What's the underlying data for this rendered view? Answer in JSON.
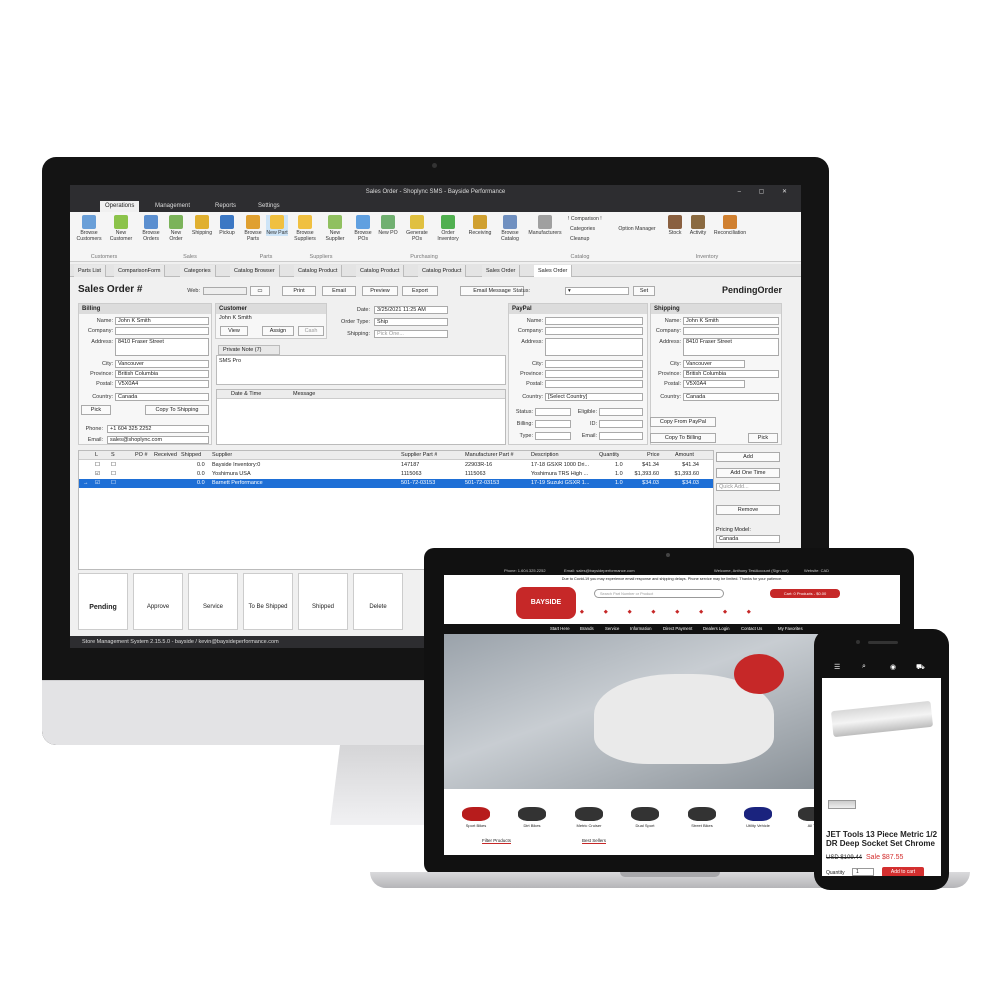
{
  "app": {
    "title": "Sales Order - Shoplync SMS - Bayside Performance",
    "menu_tabs": [
      "Operations",
      "Management",
      "Reports",
      "Settings"
    ],
    "ribbon": [
      {
        "label": "Browse Customers"
      },
      {
        "label": "New Customer"
      },
      {
        "label": "Browse Orders"
      },
      {
        "label": "New Order"
      },
      {
        "label": "Shipping"
      },
      {
        "label": "Pickup"
      },
      {
        "label": "Browse Parts"
      },
      {
        "label": "New Part"
      },
      {
        "label": "Browse Suppliers"
      },
      {
        "label": "New Supplier"
      },
      {
        "label": "Browse POs"
      },
      {
        "label": "New PO"
      },
      {
        "label": "Generate POs"
      },
      {
        "label": "Order Inventory"
      },
      {
        "label": "Receiving"
      },
      {
        "label": "Browse Catalog"
      },
      {
        "label": "Manufacturers"
      },
      {
        "label": "Stock"
      },
      {
        "label": "Activity"
      },
      {
        "label": "Reconciliation"
      }
    ],
    "ribbon_small": [
      "! Comparison !",
      "Categories",
      "Cleanup",
      "Option Manager"
    ],
    "ribbon_groups": [
      "Customers",
      "Sales",
      "Parts",
      "Suppliers",
      "Purchasing",
      "Catalog",
      "Inventory"
    ],
    "doc_tabs": [
      "Parts List",
      "ComparisonForm",
      "Categories",
      "Catalog Browser",
      "Catalog Product",
      "Catalog Product",
      "Catalog Product",
      "Sales Order",
      "Sales Order"
    ],
    "form": {
      "title": "Sales Order #",
      "web_label": "Web:",
      "print": "Print",
      "email": "Email",
      "preview": "Preview",
      "export": "Export",
      "email_message": "Email Message",
      "status_label": "Status:",
      "set": "Set",
      "order_status": "PendingOrder"
    },
    "billing": {
      "head": "Billing",
      "labels": [
        "Name:",
        "Company:",
        "Address:",
        "City:",
        "Province:",
        "Postal:",
        "Country:"
      ],
      "name": "John K Smith",
      "address": "8410 Fraser Street",
      "city": "Vancouver",
      "province": "British Columbia",
      "postal": "V5X0A4",
      "country": "Canada",
      "pick": "Pick",
      "copy": "Copy To Shipping",
      "phone_label": "Phone:",
      "phone": "+1 604 325 2252",
      "email_label": "Email:",
      "email": "sales@shoplync.com"
    },
    "customer": {
      "head": "Customer",
      "name": "John K Smith",
      "view": "View",
      "assign": "Assign",
      "cash": "Cash"
    },
    "order": {
      "date_label": "Date:",
      "date": "3/25/2021 11:25 AM",
      "type_label": "Order Type:",
      "type": "Ship",
      "shipping_label": "Shipping:",
      "shipping": "Pick One..."
    },
    "note": {
      "tab": "Private Note (7)",
      "text": "SMS Pro",
      "col_date": "Date & Time",
      "col_msg": "Message"
    },
    "paypal": {
      "head": "PayPal",
      "labels": [
        "Name:",
        "Company:",
        "Address:",
        "City:",
        "Province:",
        "Postal:",
        "Country:"
      ],
      "country": "[Select Country]",
      "status_label": "Status:",
      "billing_label": "Billing:",
      "type_label": "Type:",
      "eligible_label": "Eligible:",
      "id_label": "ID:",
      "email_label": "Email:",
      "copy_from": "Copy From PayPal",
      "copy_to": "Copy To Billing"
    },
    "shipping": {
      "head": "Shipping",
      "labels": [
        "Name:",
        "Company:",
        "Address:",
        "City:",
        "Province:",
        "Postal:",
        "Country:"
      ],
      "name": "John K Smith",
      "address": "8410 Fraser Street",
      "city": "Vancouver",
      "province": "British Columbia",
      "postal": "V5X0A4",
      "country": "Canada",
      "pick": "Pick"
    },
    "grid": {
      "headers": [
        "L",
        "S",
        "PO #",
        "Received",
        "Shipped",
        "Supplier",
        "Supplier Part #",
        "Manufacturer Part #",
        "Description",
        "Quantity",
        "Price",
        "Amount"
      ],
      "rows": [
        {
          "shipped": "0.0",
          "supplier": "Bayside Inventory:0",
          "supplier_part": "147187",
          "mfr_part": "22903R-16",
          "description": "17-18 GSXR 1000 Dri...",
          "qty": "1.0",
          "price": "$41.34",
          "amount": "$41.34"
        },
        {
          "shipped": "0.0",
          "supplier": "Yoshimura USA",
          "supplier_part": "1115063",
          "mfr_part": "1115063",
          "description": "Yoshimura TRS High ...",
          "qty": "1.0",
          "price": "$1,393.60",
          "amount": "$1,393.60"
        },
        {
          "shipped": "0.0",
          "supplier": "Barnett Performance",
          "supplier_part": "501-72-03153",
          "mfr_part": "501-72-03153",
          "description": "17-19 Suzuki GSXR 1...",
          "qty": "1.0",
          "price": "$34.03",
          "amount": "$34.03"
        }
      ]
    },
    "side": {
      "add": "Add",
      "add_one_time": "Add One Time",
      "quick_add": "Quick Add...",
      "remove": "Remove",
      "pricing_label": "Pricing Model:",
      "pricing": "Canada"
    },
    "status_buttons": [
      "Pending",
      "Approve",
      "Service",
      "To Be Shipped",
      "Shipped",
      "Delete"
    ],
    "statusbar": "Store Management System 2.15.5.0 - bayside / kevin@baysideperformance.com"
  },
  "website": {
    "phone": "Phone: 1.604.325.2252",
    "email": "Email: sales@baysideperformance.com",
    "welcome": "Welcome, Anthony TestAccount (Sign out)",
    "currency": "Website: CAD",
    "notice": "Due to Covid-19 you may experience email response and shipping delays. Phone service may be limited. Thanks for your patience.",
    "search_placeholder": "Search Part Number or Product",
    "cart": "Cart: 0 Products - $0.00",
    "nav": [
      "Start Here",
      "Brands",
      "Service",
      "Information",
      "Direct Payment",
      "Dealers Login",
      "Contact Us",
      "My Favorites"
    ],
    "categories": [
      "Sport Bikes",
      "Dirt Bikes",
      "Metric Cruiser",
      "Dual Sport",
      "Street Bikes",
      "Utility Vehicle",
      "All Ti"
    ],
    "tabs": [
      "Filter Products",
      "Best Sellers"
    ]
  },
  "phone": {
    "product": "JET Tools 13 Piece Metric 1/2 DR Deep Socket Set Chrome",
    "old_price": "USD $109.44",
    "sale_price": "Sale $87.55",
    "qty_label": "Quantity",
    "qty": "1",
    "add_cart": "Add to cart"
  }
}
